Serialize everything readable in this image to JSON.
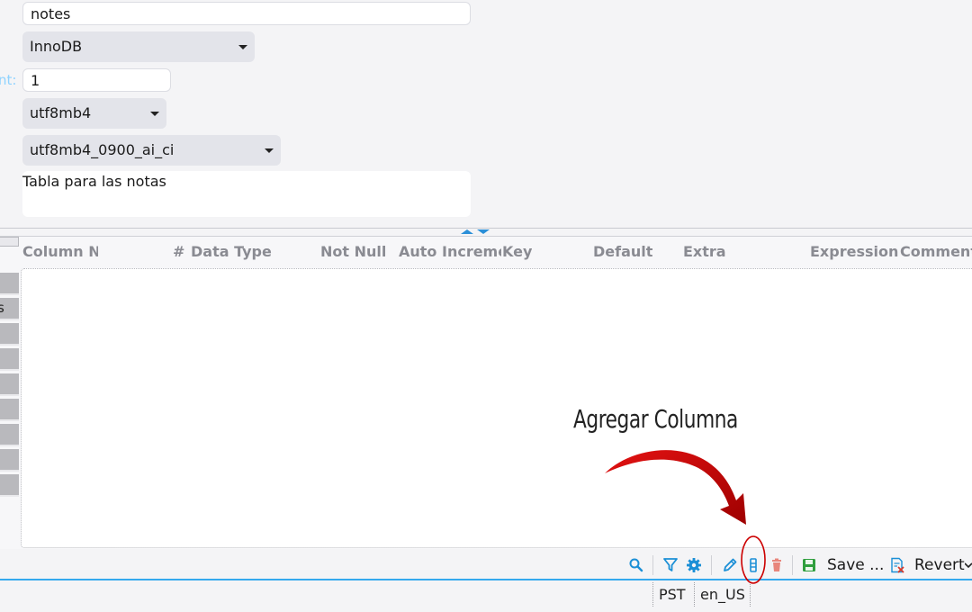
{
  "form": {
    "table_name": "notes",
    "engine": "InnoDB",
    "auto_increment_label_fragment": "nt:",
    "auto_increment": "1",
    "charset": "utf8mb4",
    "collation": "utf8mb4_0900_ai_ci",
    "comment": "Tabla para las notas"
  },
  "columns_table": {
    "headers": [
      "Column Na",
      "#",
      "Data Type",
      "Not Null",
      "Auto Incremer",
      "Key",
      "Default",
      "Extra",
      "Expression",
      "Comment"
    ]
  },
  "left_strip": {
    "partial_label": "s"
  },
  "toolbar": {
    "icons": [
      "search-icon",
      "filter-icon",
      "gear-icon",
      "edit-icon",
      "add-column-icon",
      "delete-icon",
      "save-icon",
      "revert-icon"
    ],
    "save_label": "Save ...",
    "revert_label": "Revert"
  },
  "status_bar": {
    "timezone": "PST",
    "locale": "en_US"
  },
  "annotation": {
    "text": "Agregar Columna",
    "color": "#cc0000"
  },
  "colors": {
    "accent": "#35a9ee",
    "toolbar_icon": "#1b8fd6",
    "delete_icon": "#e8867c",
    "save_icon": "#2f9e3d"
  }
}
